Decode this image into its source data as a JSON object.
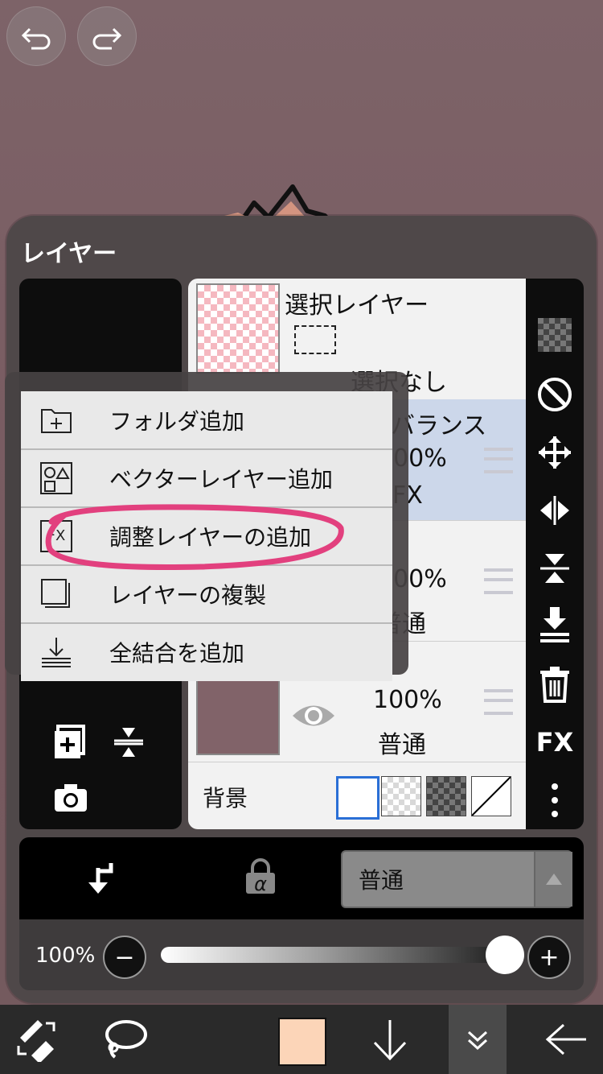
{
  "panel": {
    "title": "レイヤー"
  },
  "layers": [
    {
      "name": "選択レイヤー",
      "sub": "選択なし"
    },
    {
      "name": "バランス",
      "opacity": "100%",
      "mode": "FX"
    },
    {
      "opacity": "100%",
      "mode": "普通"
    },
    {
      "opacity": "100%",
      "mode": "普通"
    }
  ],
  "background": {
    "label": "背景"
  },
  "menu": {
    "items": [
      {
        "label": "フォルダ追加",
        "icon": "folder-add-icon"
      },
      {
        "label": "ベクターレイヤー追加",
        "icon": "vector-layer-icon"
      },
      {
        "label": "調整レイヤーの追加",
        "icon": "fx-layer-icon"
      },
      {
        "label": "レイヤーの複製",
        "icon": "duplicate-icon"
      },
      {
        "label": "全結合を追加",
        "icon": "merge-all-icon"
      }
    ]
  },
  "blend": {
    "mode": "普通",
    "alpha_lock": "α"
  },
  "opacity": {
    "label": "100%",
    "value": 1.0
  },
  "right_tools": {
    "fx_label": "FX"
  },
  "colors": {
    "current_color": "#fcd5b8",
    "highlight_row": "#ccd7ea",
    "annotation": "#e2407e"
  }
}
